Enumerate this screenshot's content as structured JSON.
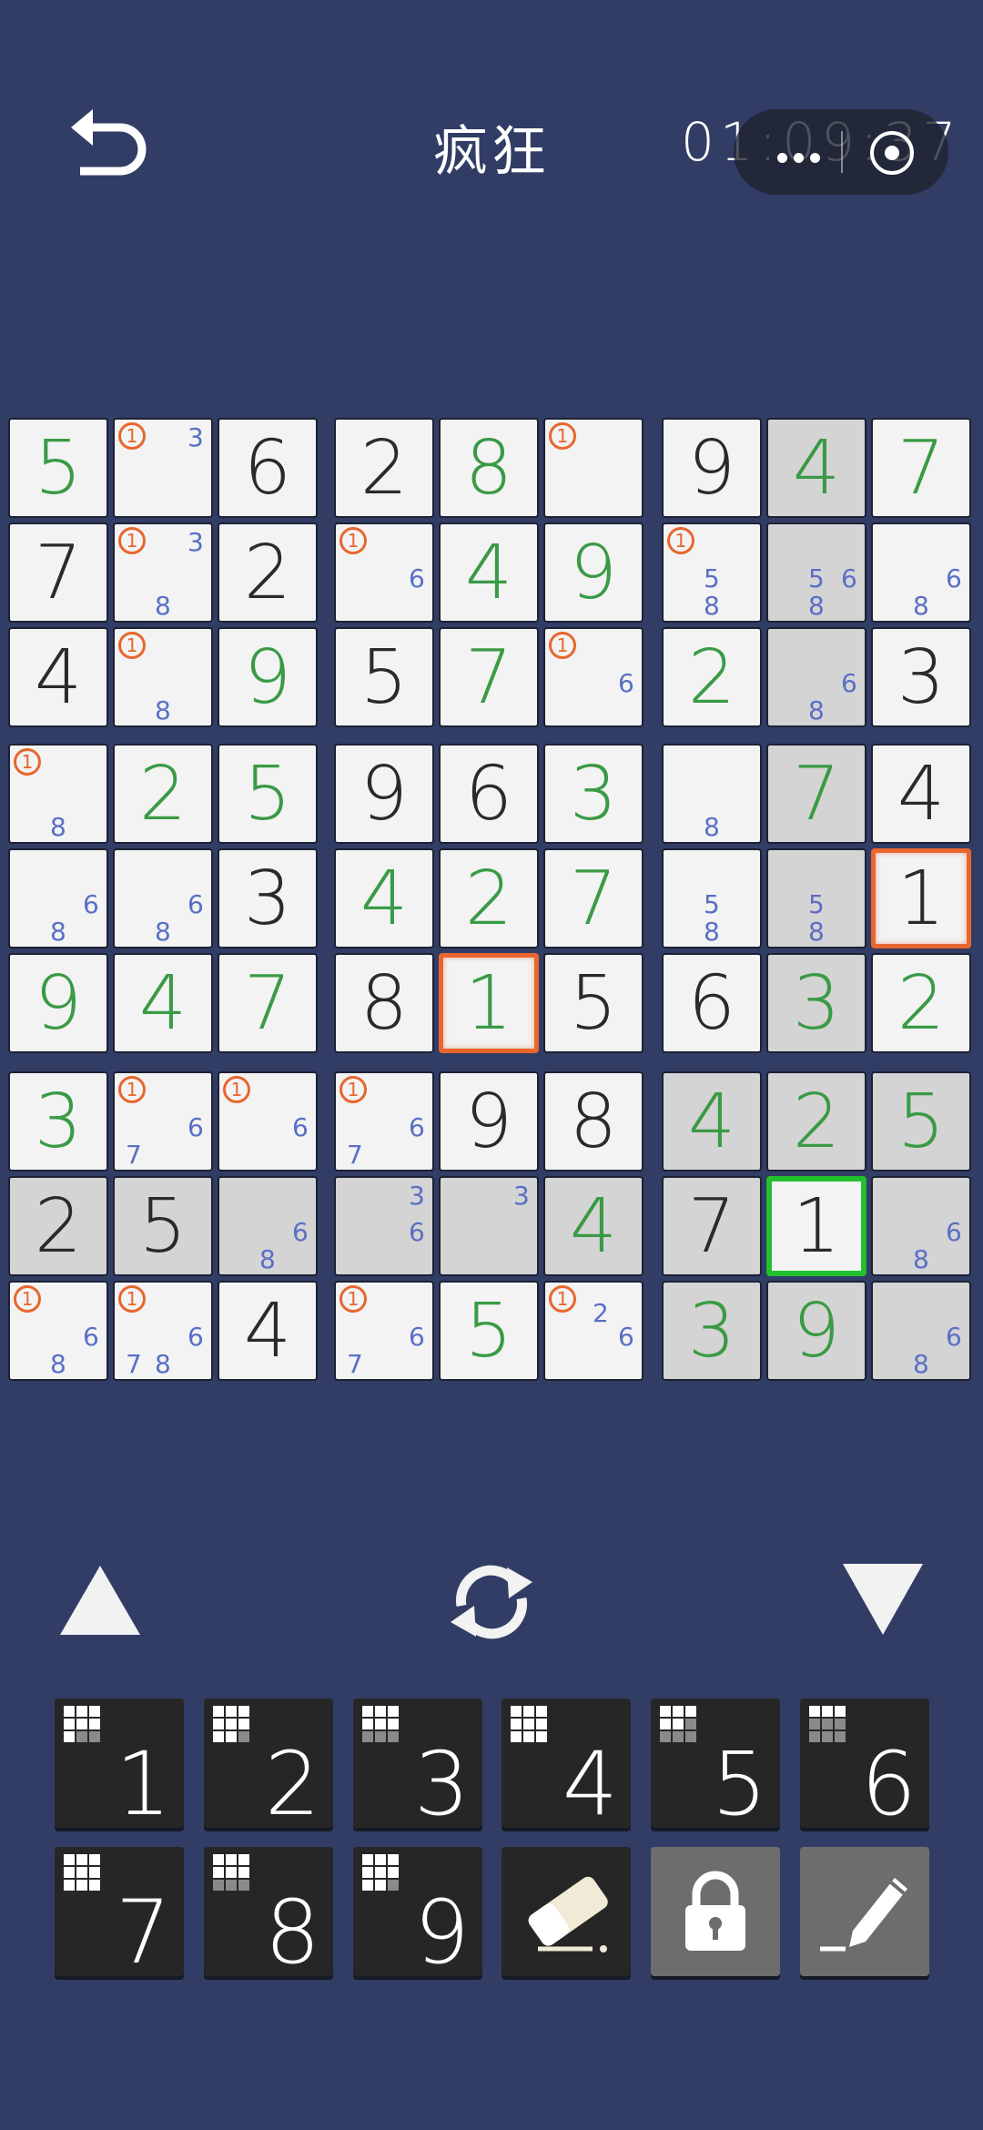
{
  "header": {
    "title": "疯狂",
    "timer": "01:09:37"
  },
  "board": {
    "cells": [
      [
        {
          "v": "5",
          "t": "user"
        },
        {
          "v": "",
          "m": "1",
          "n": "3"
        },
        {
          "v": "6",
          "t": "given"
        },
        {
          "v": "2",
          "t": "given"
        },
        {
          "v": "8",
          "t": "user"
        },
        {
          "v": "",
          "m": "1"
        },
        {
          "v": "9",
          "t": "given"
        },
        {
          "v": "4",
          "t": "user",
          "hl": true
        },
        {
          "v": "7",
          "t": "user"
        }
      ],
      [
        {
          "v": "7",
          "t": "given"
        },
        {
          "v": "",
          "m": "1",
          "n": "38"
        },
        {
          "v": "2",
          "t": "given"
        },
        {
          "v": "",
          "m": "1",
          "n": "6"
        },
        {
          "v": "4",
          "t": "user"
        },
        {
          "v": "9",
          "t": "user"
        },
        {
          "v": "",
          "m": "1",
          "n": "58"
        },
        {
          "v": "",
          "hl": true,
          "n": "568"
        },
        {
          "v": "",
          "n": "68"
        }
      ],
      [
        {
          "v": "4",
          "t": "given"
        },
        {
          "v": "",
          "m": "1",
          "n": "8"
        },
        {
          "v": "9",
          "t": "user"
        },
        {
          "v": "5",
          "t": "given"
        },
        {
          "v": "7",
          "t": "user"
        },
        {
          "v": "",
          "m": "1",
          "n": "6"
        },
        {
          "v": "2",
          "t": "user"
        },
        {
          "v": "",
          "hl": true,
          "n": "68"
        },
        {
          "v": "3",
          "t": "given"
        }
      ],
      [
        {
          "v": "",
          "m": "1",
          "n": "8"
        },
        {
          "v": "2",
          "t": "user"
        },
        {
          "v": "5",
          "t": "user"
        },
        {
          "v": "9",
          "t": "given"
        },
        {
          "v": "6",
          "t": "given"
        },
        {
          "v": "3",
          "t": "user"
        },
        {
          "v": "",
          "n": "8"
        },
        {
          "v": "7",
          "t": "user",
          "hl": true
        },
        {
          "v": "4",
          "t": "given"
        }
      ],
      [
        {
          "v": "",
          "n": "68"
        },
        {
          "v": "",
          "n": "68"
        },
        {
          "v": "3",
          "t": "given"
        },
        {
          "v": "4",
          "t": "user"
        },
        {
          "v": "2",
          "t": "user"
        },
        {
          "v": "7",
          "t": "user"
        },
        {
          "v": "",
          "n": "58"
        },
        {
          "v": "",
          "hl": true,
          "n": "58"
        },
        {
          "v": "1",
          "t": "given",
          "err": true
        }
      ],
      [
        {
          "v": "9",
          "t": "user"
        },
        {
          "v": "4",
          "t": "user"
        },
        {
          "v": "7",
          "t": "user"
        },
        {
          "v": "8",
          "t": "given"
        },
        {
          "v": "1",
          "t": "user",
          "err": true
        },
        {
          "v": "5",
          "t": "given"
        },
        {
          "v": "6",
          "t": "given"
        },
        {
          "v": "3",
          "t": "user",
          "hl": true
        },
        {
          "v": "2",
          "t": "user"
        }
      ],
      [
        {
          "v": "3",
          "t": "user"
        },
        {
          "v": "",
          "m": "1",
          "n": "67"
        },
        {
          "v": "",
          "m": "1",
          "n": "6"
        },
        {
          "v": "",
          "m": "1",
          "n": "67"
        },
        {
          "v": "9",
          "t": "given"
        },
        {
          "v": "8",
          "t": "given"
        },
        {
          "v": "4",
          "t": "user",
          "hl": true
        },
        {
          "v": "2",
          "t": "user",
          "hl": true
        },
        {
          "v": "5",
          "t": "user",
          "hl": true
        }
      ],
      [
        {
          "v": "2",
          "t": "given",
          "hl": true
        },
        {
          "v": "5",
          "t": "given",
          "hl": true
        },
        {
          "v": "",
          "hl": true,
          "n": "68"
        },
        {
          "v": "",
          "hl": true,
          "n": "36"
        },
        {
          "v": "",
          "hl": true,
          "n": "3"
        },
        {
          "v": "4",
          "t": "user",
          "hl": true
        },
        {
          "v": "7",
          "t": "given",
          "hl": true
        },
        {
          "v": "1",
          "t": "given",
          "sel": true
        },
        {
          "v": "",
          "hl": true,
          "n": "68"
        }
      ],
      [
        {
          "v": "",
          "m": "1",
          "n": "68"
        },
        {
          "v": "",
          "m": "1",
          "n": "678"
        },
        {
          "v": "4",
          "t": "given"
        },
        {
          "v": "",
          "m": "1",
          "n": "67"
        },
        {
          "v": "5",
          "t": "user"
        },
        {
          "v": "",
          "m": "1",
          "n": "26"
        },
        {
          "v": "3",
          "t": "user",
          "hl": true
        },
        {
          "v": "9",
          "t": "user",
          "hl": true
        },
        {
          "v": "",
          "hl": true,
          "n": "68"
        }
      ]
    ]
  },
  "keypad": {
    "digits": [
      "1",
      "2",
      "3",
      "4",
      "5",
      "6",
      "7",
      "8",
      "9"
    ],
    "remaining": [
      7,
      8,
      6,
      9,
      5,
      3,
      9,
      6,
      8
    ]
  },
  "icons": {
    "back": "undo-arrow-icon",
    "up": "triangle-up-icon",
    "refresh": "refresh-icon",
    "down": "triangle-down-icon",
    "eraser": "eraser-icon",
    "lock": "lock-icon",
    "pencil": "pencil-icon"
  },
  "colors": {
    "background": "#323d66",
    "given": "#2a2a2a",
    "user": "#3a9a45",
    "note": "#5a6fc6",
    "error": "#e8662e",
    "selected": "#22c02f"
  }
}
